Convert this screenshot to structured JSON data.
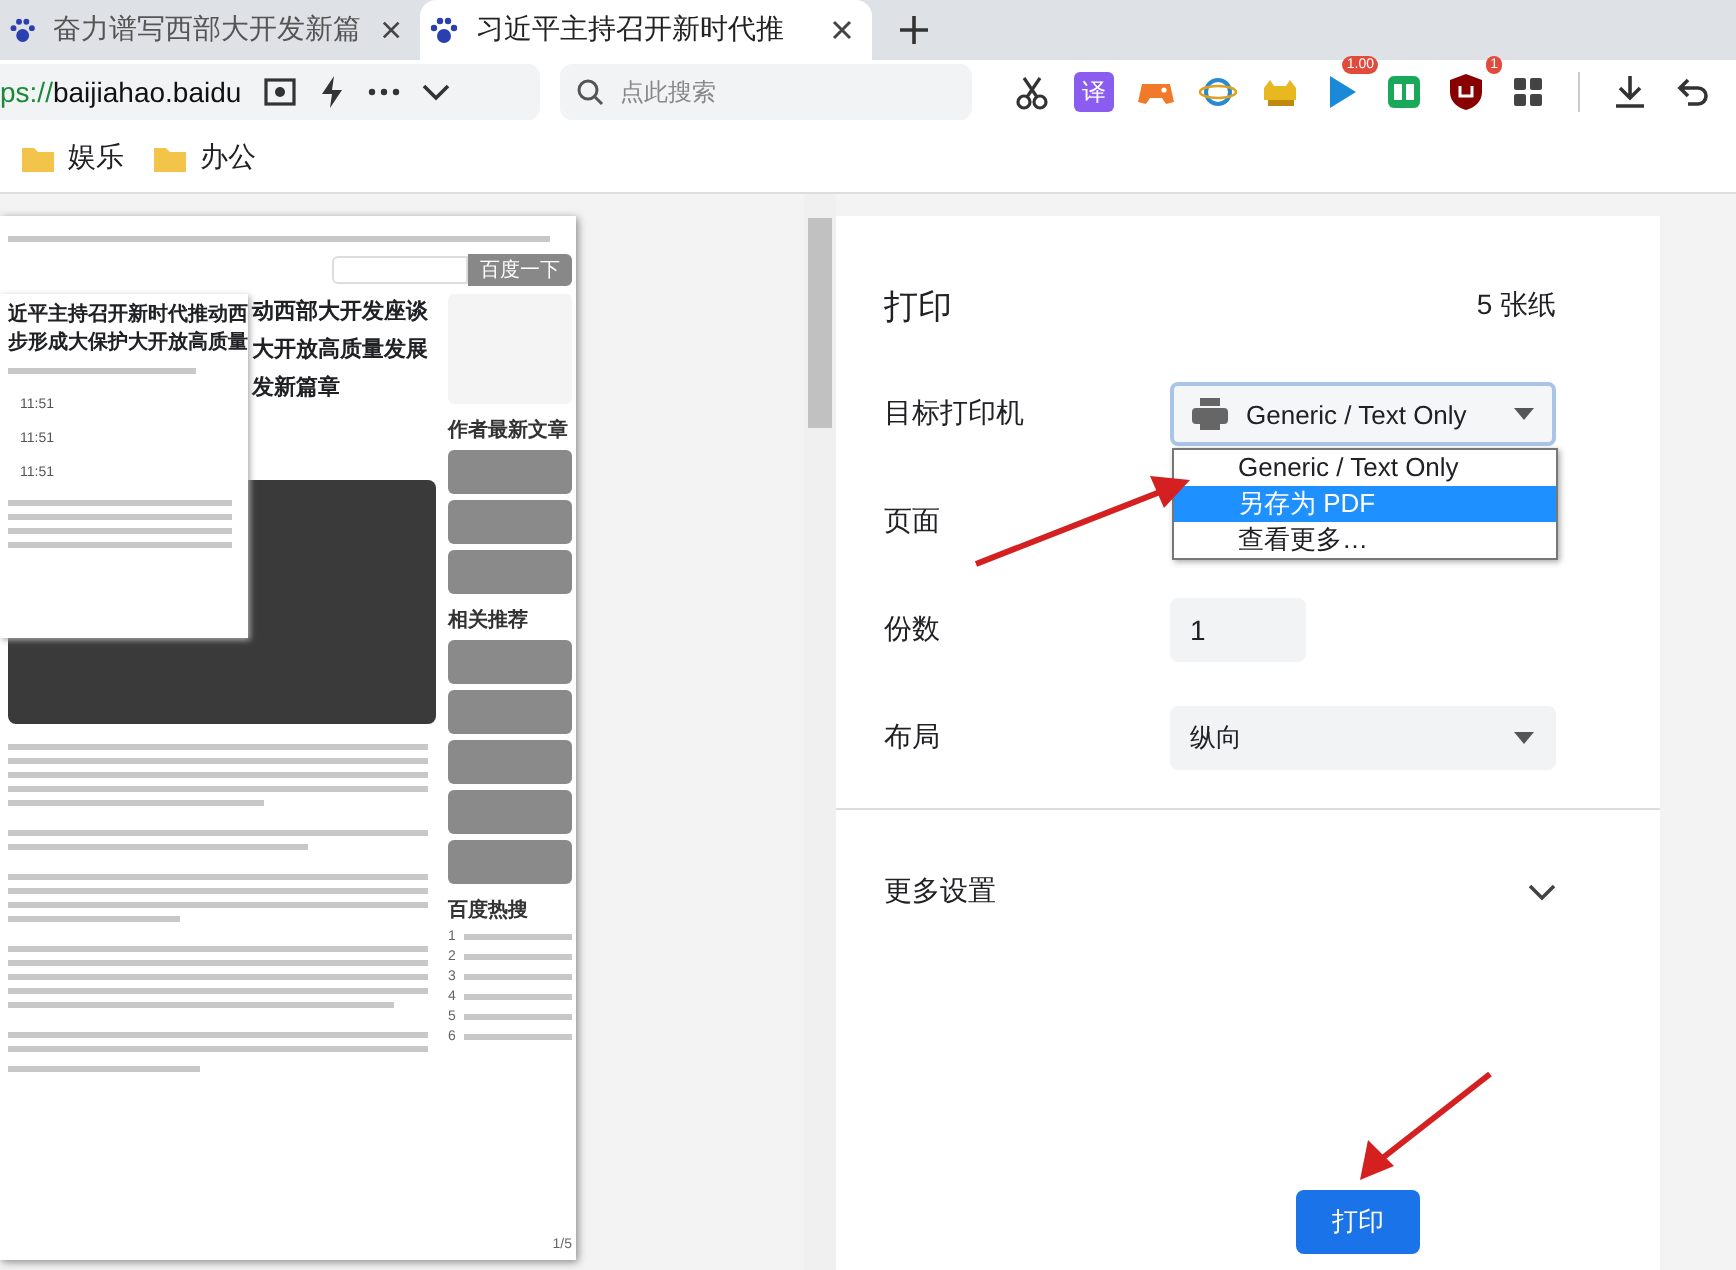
{
  "browser": {
    "tabs": [
      {
        "title": "奋力谱写西部大开发新篇",
        "selected": false
      },
      {
        "title": "习近平主持召开新时代推",
        "selected": true
      }
    ],
    "address": {
      "scheme": "ps://",
      "host": "baijiahao.baidu"
    },
    "search": {
      "placeholder": "点此搜索"
    },
    "extensions": [
      {
        "kind": "scissors"
      },
      {
        "kind": "translate",
        "label": "译"
      },
      {
        "kind": "gamepad"
      },
      {
        "kind": "globe"
      },
      {
        "kind": "cat"
      },
      {
        "kind": "play",
        "badge": "1.00"
      },
      {
        "kind": "book"
      },
      {
        "kind": "shield",
        "badge": "1"
      },
      {
        "kind": "grid"
      }
    ],
    "bookmarks": [
      "娱乐",
      "办公"
    ]
  },
  "preview": {
    "search_button": "百度一下",
    "overlay": {
      "title_lines": [
        "近平主持召开新时代推动西",
        "步形成大保护大开放高质量"
      ],
      "times": [
        "11:51",
        "11:51",
        "11:51"
      ]
    },
    "headline_lines": [
      "动西部大开发座谈",
      "大开放高质量发展",
      "发新篇章"
    ],
    "sidebar_sections": [
      "作者最新文章",
      "相关推荐",
      "百度热搜"
    ],
    "hot_numbers": [
      "1",
      "2",
      "3",
      "4",
      "5",
      "6"
    ],
    "page_number": "1/5"
  },
  "print_panel": {
    "title": "打印",
    "sheet_count": "5 张纸",
    "destination": {
      "label": "目标打印机",
      "value": "Generic / Text Only",
      "options": [
        {
          "label": "Generic / Text Only",
          "highlighted": false
        },
        {
          "label": "另存为 PDF",
          "highlighted": true
        },
        {
          "label": "查看更多…",
          "highlighted": false
        }
      ]
    },
    "pages": {
      "label": "页面"
    },
    "copies": {
      "label": "份数",
      "value": "1"
    },
    "layout": {
      "label": "布局",
      "value": "纵向"
    },
    "more_settings": {
      "label": "更多设置",
      "expanded": false
    },
    "print_button": "打印"
  }
}
